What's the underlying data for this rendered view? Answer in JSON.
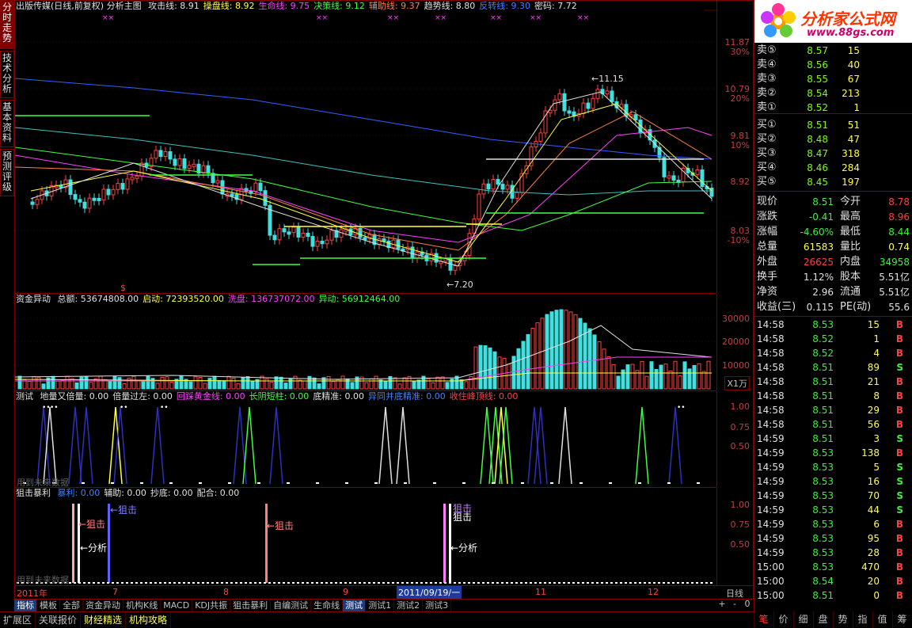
{
  "side_tabs": [
    "分时走势",
    "技术分析",
    "基本资料",
    "预测评级"
  ],
  "header": {
    "title": "出版传媒(日线,前复权) 分析主图",
    "items": [
      {
        "label": "攻击线: 8.91",
        "color": "#e0e0e0"
      },
      {
        "label": "操盘线: 8.92",
        "color": "#ffff40"
      },
      {
        "label": "生命线: 9.75",
        "color": "#ff40ff"
      },
      {
        "label": "决策线: 9.12",
        "color": "#40ff40"
      },
      {
        "label": "辅助线: 9.37",
        "color": "#ff8040"
      },
      {
        "label": "趋势线: 8.80",
        "color": "#e0e0e0"
      },
      {
        "label": "反转线: 9.30",
        "color": "#4080ff"
      },
      {
        "label": "密码: 7.72",
        "color": "#e0e0e0"
      }
    ]
  },
  "price_axis": [
    "11.87",
    "30%",
    "10.79",
    "20%",
    "9.81",
    "10%",
    "8.92",
    "8.03",
    "-10%"
  ],
  "annotations": {
    "high": "11.15",
    "low": "7.20",
    "flag": "$"
  },
  "fund_panel": {
    "title": "资金异动",
    "items": [
      {
        "label": "总额: 53674808.00",
        "color": "#e0e0e0"
      },
      {
        "label": "启动: 72393520.00",
        "color": "#ffff40"
      },
      {
        "label": "洗盘: 136737072.00",
        "color": "#ff40ff"
      },
      {
        "label": "异动: 56912464.00",
        "color": "#40ff40"
      }
    ],
    "axis": [
      "30000",
      "20000",
      "10000"
    ],
    "unit": "X1万"
  },
  "test_panel": {
    "title": "测试",
    "items": [
      {
        "label": "地量又倍量: 0.00",
        "color": "#e0e0e0"
      },
      {
        "label": "倍量过左: 0.00",
        "color": "#e0e0e0"
      },
      {
        "label": "回踩黄金线: 0.00",
        "color": "#ff40ff"
      },
      {
        "label": "长阴短柱: 0.00",
        "color": "#40ff40"
      },
      {
        "label": "底精准: 0.00",
        "color": "#e0e0e0"
      },
      {
        "label": "异同并底精准: 0.00",
        "color": "#4080ff"
      },
      {
        "label": "收住峰顶线: 0.00",
        "color": "#ff4040"
      }
    ],
    "axis": [
      "1.00",
      "0.75",
      "0.50"
    ],
    "watermark": "用到未来数据"
  },
  "snipe_panel": {
    "title": "狙击暴利",
    "items": [
      {
        "label": "暴利: 0.00",
        "color": "#4080ff"
      },
      {
        "label": "辅助: 0.00",
        "color": "#e0e0e0"
      },
      {
        "label": "抄底: 0.00",
        "color": "#e0e0e0"
      },
      {
        "label": "配合: 0.00",
        "color": "#e0e0e0"
      }
    ],
    "axis": [
      "1.00",
      "0.75",
      "0.50"
    ],
    "labels": [
      "←狙击",
      "←分析",
      "←狙击",
      "←狙击",
      "狙击",
      "狙击",
      "←分析"
    ],
    "watermark": "用到未来数据"
  },
  "date_axis": {
    "labels": [
      "2011年",
      "7",
      "8",
      "9",
      "2011/09/19/一",
      "11",
      "12"
    ],
    "period": "日线"
  },
  "bottom_tabs": [
    "指标",
    "模板",
    "全部",
    "资金异动",
    "机构K线",
    "MACD",
    "KDJ共振",
    "狙击暴利",
    "自编测试",
    "生命线",
    "测试",
    "测试1",
    "测试2",
    "测试3"
  ],
  "bottom_bar": [
    "扩展区",
    "关联报价",
    "财经精选",
    "机构攻略"
  ],
  "right_buttons": [
    "笔",
    "价",
    "细",
    "盘",
    "势",
    "指",
    "值",
    "筹"
  ],
  "zoom_buttons": [
    "+",
    "-",
    "0"
  ],
  "logo": {
    "title": "分析家公式网",
    "url": "www.88gs.com"
  },
  "order_book": {
    "asks": [
      {
        "l": "卖⑤",
        "p": "8.57",
        "v": "15"
      },
      {
        "l": "卖④",
        "p": "8.56",
        "v": "40"
      },
      {
        "l": "卖③",
        "p": "8.55",
        "v": "67"
      },
      {
        "l": "卖②",
        "p": "8.54",
        "v": "213"
      },
      {
        "l": "卖①",
        "p": "8.52",
        "v": "1"
      }
    ],
    "bids": [
      {
        "l": "买①",
        "p": "8.51",
        "v": "51"
      },
      {
        "l": "买②",
        "p": "8.48",
        "v": "47"
      },
      {
        "l": "买③",
        "p": "8.47",
        "v": "318"
      },
      {
        "l": "买④",
        "p": "8.46",
        "v": "284"
      },
      {
        "l": "买⑤",
        "p": "8.45",
        "v": "197"
      }
    ]
  },
  "quote": [
    {
      "k1": "现价",
      "v1": "8.51",
      "c1": "grn",
      "k2": "今开",
      "v2": "8.78",
      "c2": "red"
    },
    {
      "k1": "涨跌",
      "v1": "-0.41",
      "c1": "grn",
      "k2": "最高",
      "v2": "8.96",
      "c2": "red"
    },
    {
      "k1": "涨幅",
      "v1": "-4.60%",
      "c1": "grn",
      "k2": "最低",
      "v2": "8.44",
      "c2": "grn"
    },
    {
      "k1": "总量",
      "v1": "61583",
      "c1": "yel",
      "k2": "量比",
      "v2": "0.74",
      "c2": "yel"
    },
    {
      "k1": "外盘",
      "v1": "26625",
      "c1": "red",
      "k2": "内盘",
      "v2": "34958",
      "c2": "grn"
    },
    {
      "k1": "换手",
      "v1": "1.12%",
      "c1": "wht",
      "k2": "股本",
      "v2": "5.51亿",
      "c2": "wht"
    },
    {
      "k1": "净资",
      "v1": "2.96",
      "c1": "wht",
      "k2": "流通",
      "v2": "5.51亿",
      "c2": "wht"
    },
    {
      "k1": "收益(三)",
      "v1": "0.115",
      "c1": "wht",
      "k2": "PE(动)",
      "v2": "55.6",
      "c2": "wht"
    }
  ],
  "ticks": [
    {
      "t": "14:58",
      "p": "8.53",
      "v": "15",
      "s": "B"
    },
    {
      "t": "14:58",
      "p": "8.52",
      "v": "1",
      "s": "B"
    },
    {
      "t": "14:58",
      "p": "8.52",
      "v": "4",
      "s": "B"
    },
    {
      "t": "14:58",
      "p": "8.51",
      "v": "89",
      "s": "S"
    },
    {
      "t": "14:58",
      "p": "8.51",
      "v": "21",
      "s": "B"
    },
    {
      "t": "14:58",
      "p": "8.51",
      "v": "8",
      "s": "B"
    },
    {
      "t": "14:58",
      "p": "8.51",
      "v": "29",
      "s": "B"
    },
    {
      "t": "14:58",
      "p": "8.51",
      "v": "56",
      "s": "B"
    },
    {
      "t": "14:59",
      "p": "8.51",
      "v": "3",
      "s": "S"
    },
    {
      "t": "14:59",
      "p": "8.53",
      "v": "138",
      "s": "B"
    },
    {
      "t": "14:59",
      "p": "8.53",
      "v": "5",
      "s": "S"
    },
    {
      "t": "14:59",
      "p": "8.53",
      "v": "16",
      "s": "S"
    },
    {
      "t": "14:59",
      "p": "8.53",
      "v": "70",
      "s": "S"
    },
    {
      "t": "14:59",
      "p": "8.53",
      "v": "44",
      "s": "S"
    },
    {
      "t": "14:59",
      "p": "8.53",
      "v": "6",
      "s": "B"
    },
    {
      "t": "14:59",
      "p": "8.53",
      "v": "95",
      "s": "B"
    },
    {
      "t": "14:59",
      "p": "8.53",
      "v": "28",
      "s": "B"
    },
    {
      "t": "15:00",
      "p": "8.53",
      "v": "470",
      "s": "B"
    },
    {
      "t": "15:00",
      "p": "8.54",
      "v": "20",
      "s": "B"
    },
    {
      "t": "15:00",
      "p": "8.51",
      "v": "0",
      "s": "B"
    }
  ]
}
